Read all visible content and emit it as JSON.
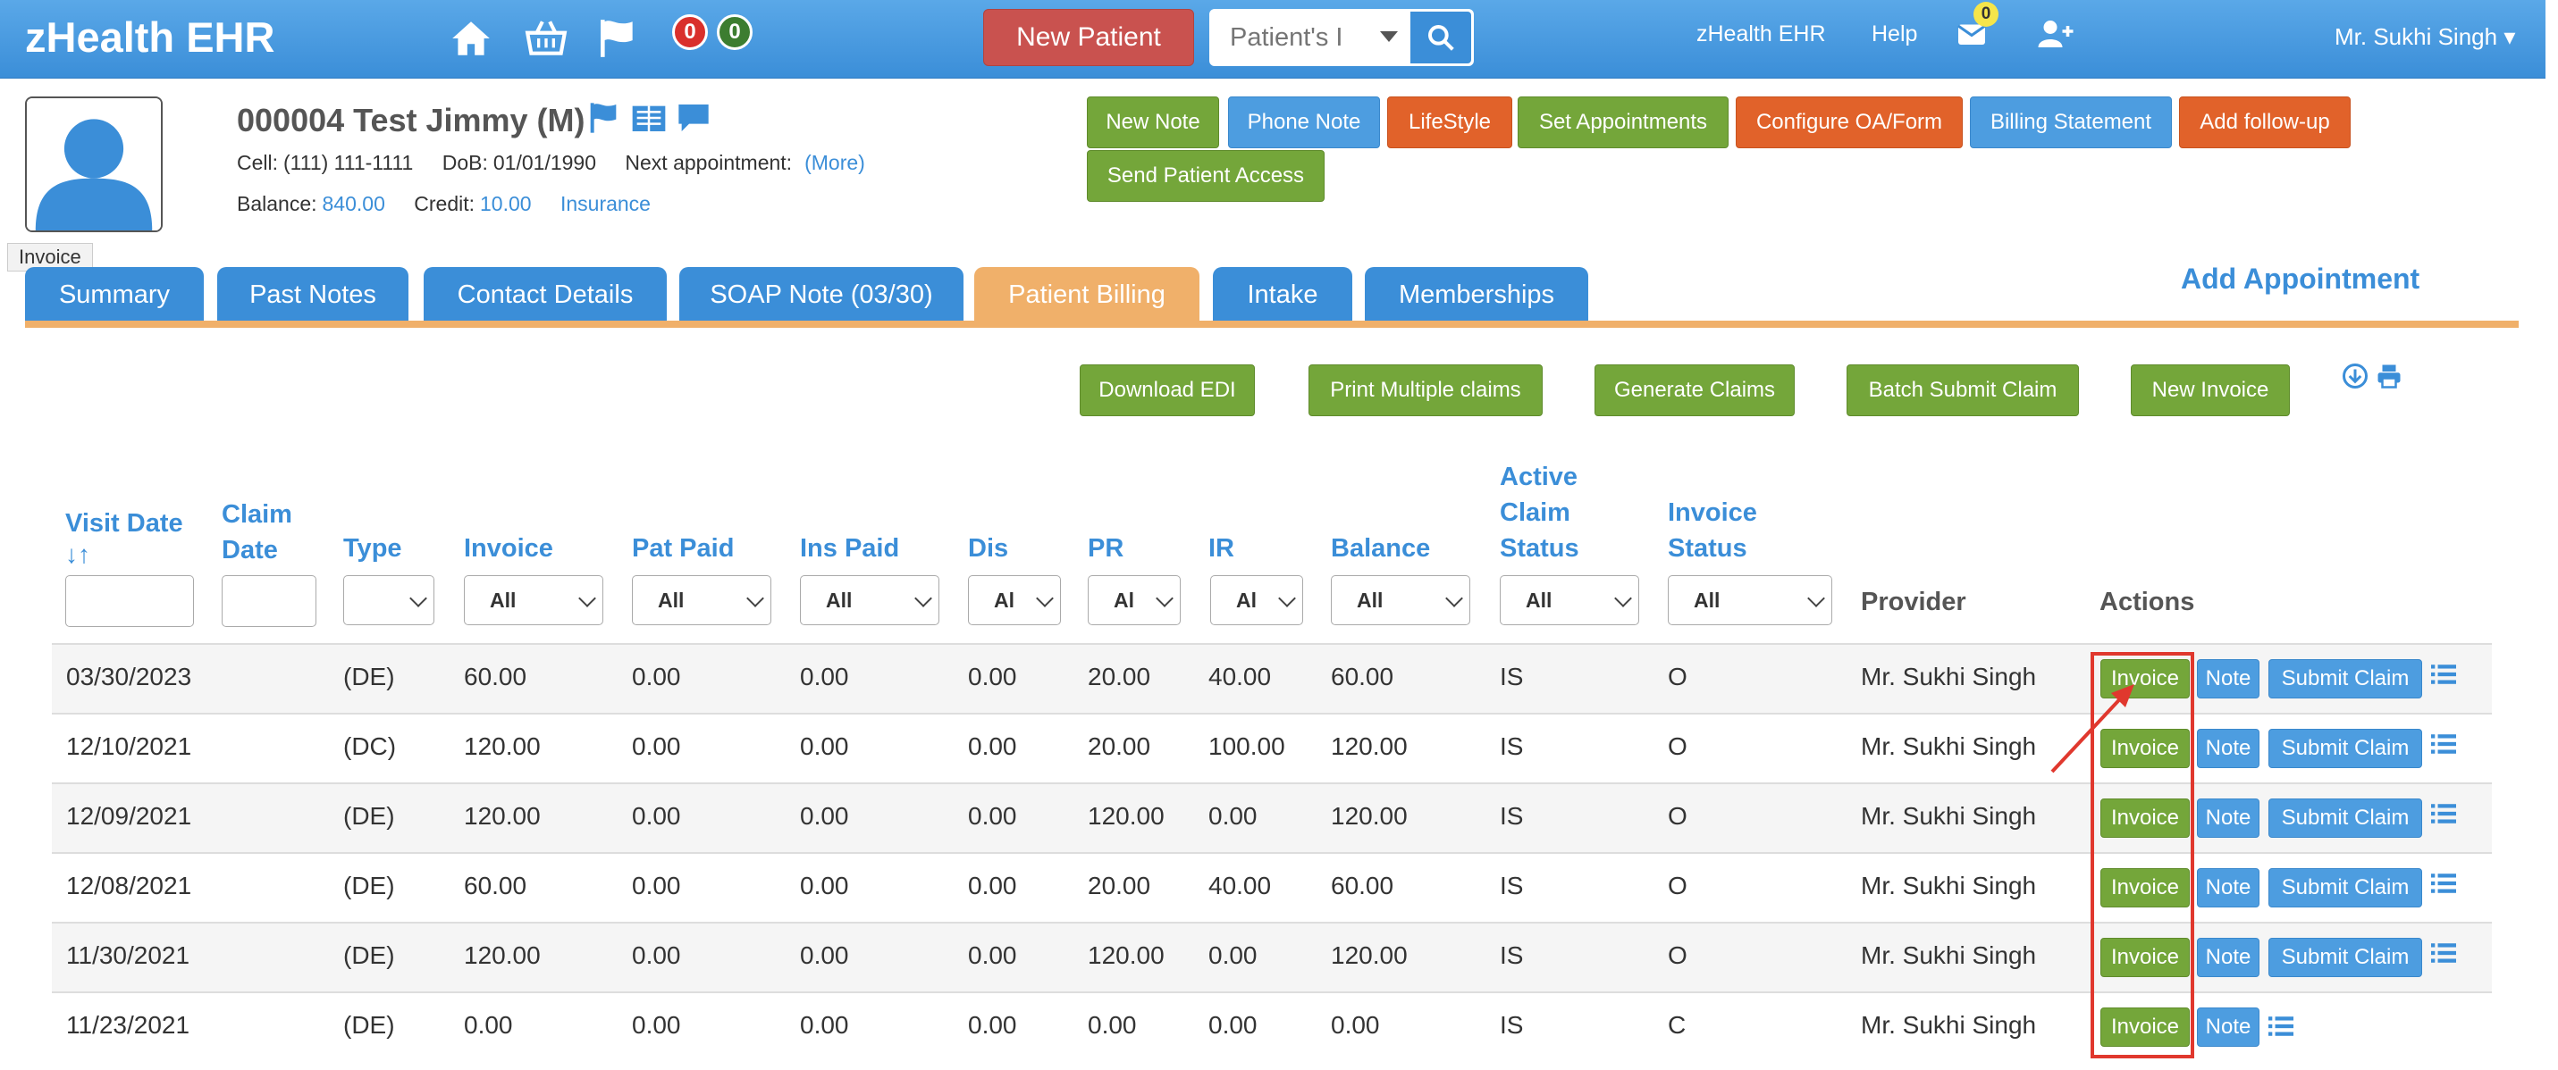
{
  "navbar": {
    "brand": "zHealth EHR",
    "icons": [
      "home-icon",
      "basket-icon",
      "flag-icon"
    ],
    "badge_red": "0",
    "badge_green": "0",
    "new_patient": "New Patient",
    "search_placeholder": "Patient's I",
    "links": [
      "zHealth EHR",
      "Help"
    ],
    "mail_count": "0",
    "user": "Mr. Sukhi Singh",
    "colors": {
      "navbar": "#3b8ed8",
      "new_patient": "#c9524f"
    }
  },
  "patient": {
    "name": "000004 Test Jimmy (M)",
    "cell_label": "Cell:",
    "cell": "(111) 111-1111",
    "dob_label": "DoB:",
    "dob": "01/01/1990",
    "next_appt_label": "Next appointment:",
    "more": "(More)",
    "balance_label": "Balance:",
    "balance": "840.00",
    "credit_label": "Credit:",
    "credit": "10.00",
    "insurance": "Insurance",
    "tooltip": "Invoice"
  },
  "actions": {
    "new_note": "New Note",
    "phone_note": "Phone Note",
    "lifestyle": "LifeStyle",
    "set_appointments": "Set Appointments",
    "configure": "Configure OA/Form",
    "billing_statement": "Billing Statement",
    "add_followup": "Add follow-up",
    "send_access": "Send Patient Access"
  },
  "tabs": [
    {
      "label": "Summary",
      "active": false
    },
    {
      "label": "Past Notes",
      "active": false
    },
    {
      "label": "Contact Details",
      "active": false
    },
    {
      "label": "SOAP Note (03/30)",
      "active": false
    },
    {
      "label": "Patient Billing",
      "active": true
    },
    {
      "label": "Intake",
      "active": false
    },
    {
      "label": "Memberships",
      "active": false
    }
  ],
  "add_appointment": "Add Appointment",
  "toolbar": {
    "download_edi": "Download EDI",
    "print_claims": "Print Multiple claims",
    "generate_claims": "Generate Claims",
    "batch_submit": "Batch Submit Claim",
    "new_invoice": "New Invoice"
  },
  "table": {
    "headers": {
      "visit_date": "Visit Date",
      "claim_date_1": "Claim",
      "claim_date_2": "Date",
      "type": "Type",
      "invoice": "Invoice",
      "pat_paid": "Pat Paid",
      "ins_paid": "Ins Paid",
      "dis": "Dis",
      "pr": "PR",
      "ir": "IR",
      "balance": "Balance",
      "acs_1": "Active",
      "acs_2": "Claim",
      "acs_3": "Status",
      "inv_status_1": "Invoice",
      "inv_status_2": "Status",
      "provider": "Provider",
      "actions": "Actions"
    },
    "filters": {
      "invoice": "All",
      "pat_paid": "All",
      "ins_paid": "All",
      "dis": "Al",
      "pr": "Al",
      "ir": "Al",
      "balance": "All",
      "acs": "All",
      "inv_status": "All"
    },
    "buttons": {
      "invoice": "Invoice",
      "note": "Note",
      "submit": "Submit Claim"
    },
    "rows": [
      {
        "visit": "03/30/2023",
        "type": "(DE)",
        "invoice": "60.00",
        "pat": "0.00",
        "ins": "0.00",
        "dis": "0.00",
        "pr": "20.00",
        "ir": "40.00",
        "bal": "60.00",
        "acs": "IS",
        "inv": "O",
        "provider": "Mr. Sukhi Singh",
        "can_submit": true
      },
      {
        "visit": "12/10/2021",
        "type": "(DC)",
        "invoice": "120.00",
        "pat": "0.00",
        "ins": "0.00",
        "dis": "0.00",
        "pr": "20.00",
        "ir": "100.00",
        "bal": "120.00",
        "acs": "IS",
        "inv": "O",
        "provider": "Mr. Sukhi Singh",
        "can_submit": true
      },
      {
        "visit": "12/09/2021",
        "type": "(DE)",
        "invoice": "120.00",
        "pat": "0.00",
        "ins": "0.00",
        "dis": "0.00",
        "pr": "120.00",
        "ir": "0.00",
        "bal": "120.00",
        "acs": "IS",
        "inv": "O",
        "provider": "Mr. Sukhi Singh",
        "can_submit": true
      },
      {
        "visit": "12/08/2021",
        "type": "(DE)",
        "invoice": "60.00",
        "pat": "0.00",
        "ins": "0.00",
        "dis": "0.00",
        "pr": "20.00",
        "ir": "40.00",
        "bal": "60.00",
        "acs": "IS",
        "inv": "O",
        "provider": "Mr. Sukhi Singh",
        "can_submit": true
      },
      {
        "visit": "11/30/2021",
        "type": "(DE)",
        "invoice": "120.00",
        "pat": "0.00",
        "ins": "0.00",
        "dis": "0.00",
        "pr": "120.00",
        "ir": "0.00",
        "bal": "120.00",
        "acs": "IS",
        "inv": "O",
        "provider": "Mr. Sukhi Singh",
        "can_submit": true
      },
      {
        "visit": "11/23/2021",
        "type": "(DE)",
        "invoice": "0.00",
        "pat": "0.00",
        "ins": "0.00",
        "dis": "0.00",
        "pr": "0.00",
        "ir": "0.00",
        "bal": "0.00",
        "acs": "IS",
        "inv": "C",
        "provider": "Mr. Sukhi Singh",
        "can_submit": false
      }
    ]
  },
  "annotation": {
    "color": "#e0382e"
  }
}
